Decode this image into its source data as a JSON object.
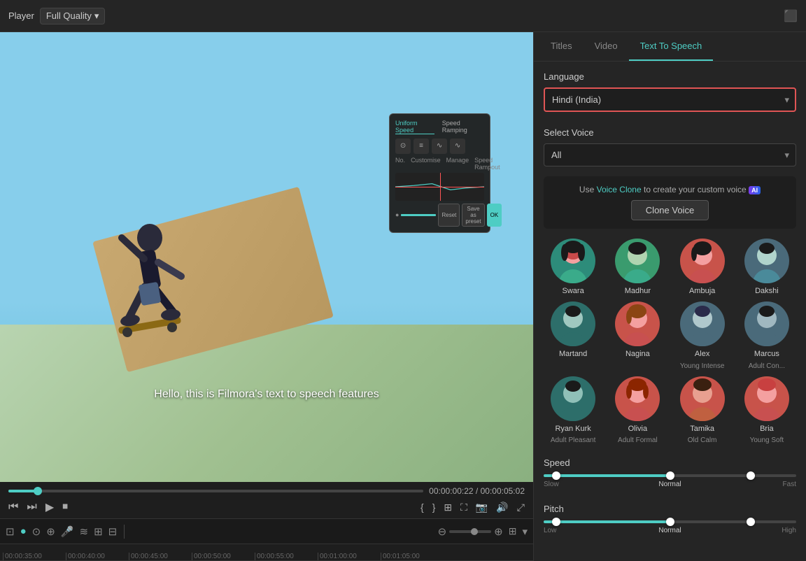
{
  "topbar": {
    "player_label": "Player",
    "quality_label": "Full Quality",
    "chevron": "▾",
    "image_icon": "⬛"
  },
  "player": {
    "caption": "Hello, this is Filmora's text to speech features",
    "current_time": "00:00:00:22",
    "total_time": "00:00:05:02",
    "popup": {
      "tab1": "Uniform Speed",
      "tab2": "Speed Ramping"
    }
  },
  "timeline": {
    "marks": [
      "00:00:35:00",
      "00:00:40:00",
      "00:00:45:00",
      "00:00:50:00",
      "00:00:55:00",
      "00:01:00:00",
      "00:01:05:00"
    ]
  },
  "right_panel": {
    "tabs": [
      {
        "label": "Titles",
        "active": false
      },
      {
        "label": "Video",
        "active": false
      },
      {
        "label": "Text To Speech",
        "active": true
      }
    ],
    "language_label": "Language",
    "language_value": "Hindi (India)",
    "select_voice_label": "Select Voice",
    "select_voice_value": "All",
    "voice_clone_text": "Use",
    "voice_clone_link": "Voice Clone",
    "voice_clone_text2": "to create your custom voice",
    "clone_voice_btn": "Clone Voice",
    "voices": [
      {
        "name": "Swara",
        "sub": "",
        "avatar_color": "av-teal",
        "emoji": "👩"
      },
      {
        "name": "Madhur",
        "sub": "",
        "avatar_color": "av-green",
        "emoji": "🧑"
      },
      {
        "name": "Ambuja",
        "sub": "",
        "avatar_color": "av-coral",
        "emoji": "👩"
      },
      {
        "name": "Dakshi",
        "sub": "",
        "avatar_color": "av-steel",
        "emoji": "🧑"
      },
      {
        "name": "Martand",
        "sub": "",
        "avatar_color": "av-dark-teal",
        "emoji": "🧑"
      },
      {
        "name": "Nagina",
        "sub": "",
        "avatar_color": "av-coral",
        "emoji": "👩"
      },
      {
        "name": "Alex",
        "sub": "Young Intense",
        "avatar_color": "av-steel",
        "emoji": "🧑"
      },
      {
        "name": "Marcus",
        "sub": "Adult Con...",
        "avatar_color": "av-steel",
        "emoji": "🧑"
      },
      {
        "name": "Ryan Kurk",
        "sub": "Adult Pleasant",
        "avatar_color": "av-dark-teal",
        "emoji": "🧑"
      },
      {
        "name": "Olivia",
        "sub": "Adult Formal",
        "avatar_color": "av-coral",
        "emoji": "👩"
      },
      {
        "name": "Tamika",
        "sub": "Old Calm",
        "avatar_color": "av-coral",
        "emoji": "👩"
      },
      {
        "name": "Bria",
        "sub": "Young Soft",
        "avatar_color": "av-coral",
        "emoji": "👩"
      }
    ],
    "speed_label": "Speed",
    "speed_slow": "Slow",
    "speed_normal": "Normal",
    "speed_fast": "Fast",
    "pitch_label": "Pitch",
    "pitch_low": "Low",
    "pitch_normal": "Normal",
    "pitch_high": "High"
  }
}
